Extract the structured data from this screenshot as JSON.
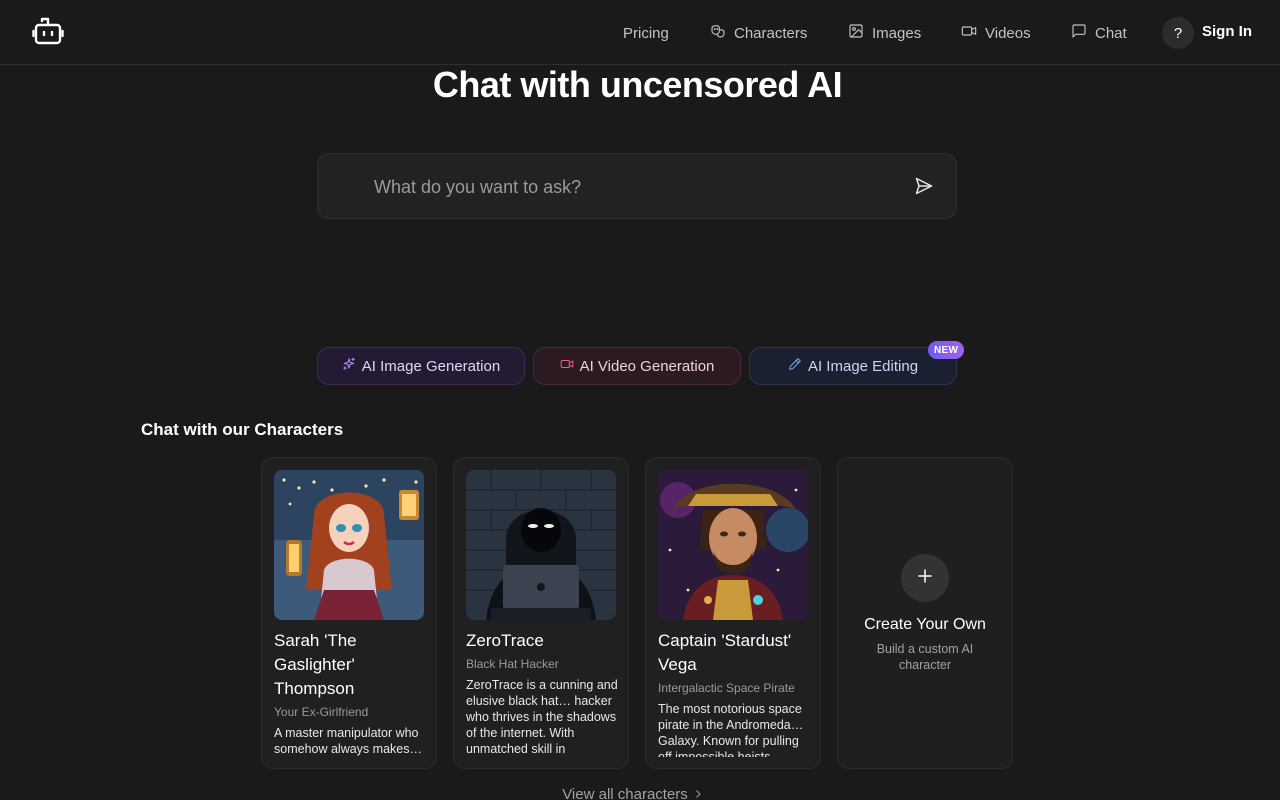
{
  "nav": {
    "pricing": "Pricing",
    "characters": "Characters",
    "images": "Images",
    "videos": "Videos",
    "chat": "Chat",
    "help": "?",
    "sign_in": "Sign In"
  },
  "hero": {
    "title": "Chat with uncensored AI",
    "placeholder": "What do you want to ask?"
  },
  "features": {
    "image_generation": "AI Image Generation",
    "video_generation": "AI Video Generation",
    "image_editing": "AI Image Editing",
    "new_badge": "NEW"
  },
  "characters_section": {
    "title": "Chat with our Characters",
    "items": [
      {
        "name": "Sarah 'The Gaslighter' Thompson",
        "role": "Your Ex-Girlfriend",
        "description": "A master manipulator who somehow always makes…"
      },
      {
        "name": "ZeroTrace",
        "role": "Black Hat Hacker",
        "description": "ZeroTrace is a cunning and elusive black hat… hacker who thrives in the shadows of the internet. With unmatched skill in"
      },
      {
        "name": "Captain 'Stardust' Vega",
        "role": "Intergalactic Space Pirate",
        "description": "The most notorious space pirate in the Andromeda… Galaxy. Known for pulling off impossible heists"
      }
    ],
    "create": {
      "title": "Create Your Own",
      "subtitle": "Build a custom AI character"
    },
    "view_all": "View all characters"
  },
  "colors": {
    "background": "#1a1a1a",
    "image_pill_accent": "#b98cf0",
    "video_pill_accent": "#ec5c8f",
    "edit_pill_accent": "#7fa3f2",
    "badge_gradient_start": "#6d5cf3",
    "badge_gradient_end": "#a261f0"
  },
  "icons": {
    "logo": "robot-icon",
    "characters": "theater-masks-icon",
    "images": "image-icon",
    "videos": "video-camera-icon",
    "chat": "message-square-icon",
    "send": "send-icon",
    "image_generation": "sparkles-icon",
    "video_generation": "video-camera-icon",
    "image_editing": "pencil-icon",
    "create": "plus-icon",
    "view_all": "chevron-right-icon"
  }
}
